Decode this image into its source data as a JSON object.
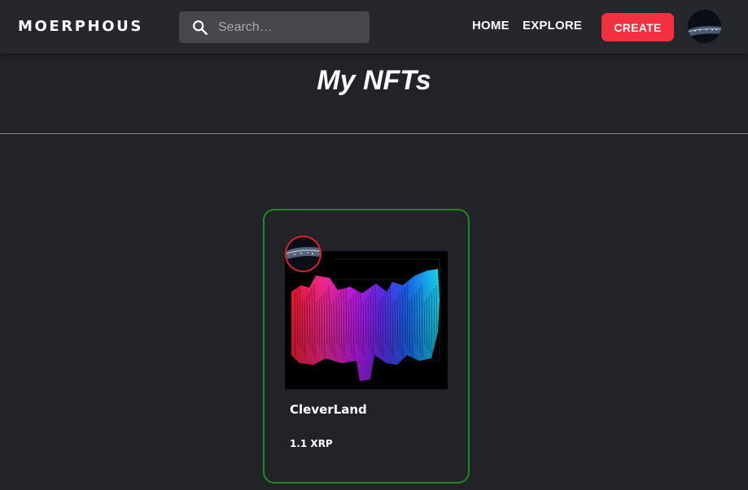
{
  "header": {
    "logo": "MOERPHOUS",
    "search_placeholder": "Search…",
    "nav": {
      "home": "HOME",
      "explore": "EXPLORE"
    },
    "create_label": "CREATE"
  },
  "page": {
    "title": "My NFTs"
  },
  "nfts": [
    {
      "name": "CleverLand",
      "price": "1.1 XRP"
    }
  ],
  "colors": {
    "background": "#212328",
    "header": "#25272c",
    "create_button": "#f2303f",
    "card_border": "#1c8a1c",
    "owner_ring": "#e0202a"
  }
}
